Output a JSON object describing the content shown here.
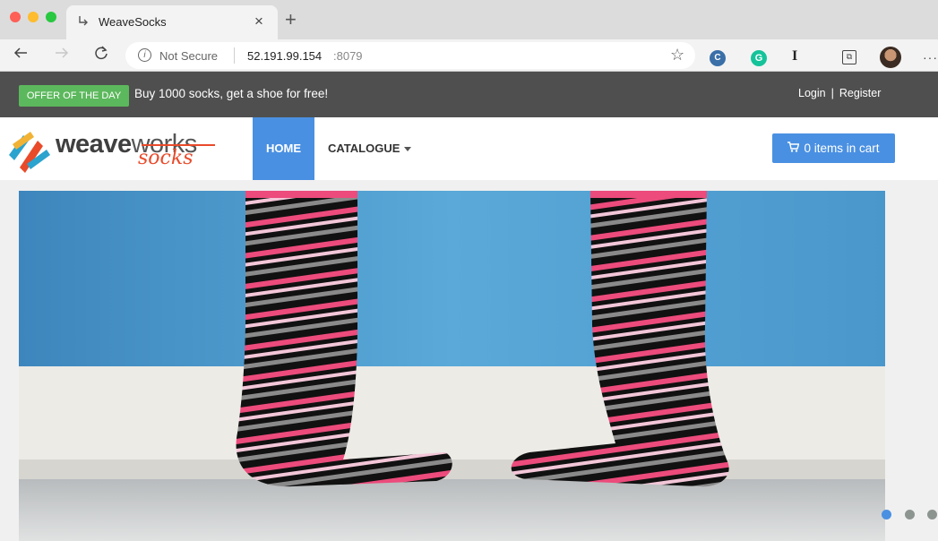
{
  "browser": {
    "tab_title": "WeaveSocks",
    "tab_close": "×",
    "new_tab": "+",
    "security_label": "Not Secure",
    "url_host": "52.191.99.154",
    "url_port": ":8079",
    "extensions": [
      "C",
      "G",
      "I",
      "⧉"
    ]
  },
  "offer": {
    "badge": "OFFER OF THE DAY",
    "text": "Buy 1000 socks, get a shoe for free!"
  },
  "auth": {
    "login": "Login",
    "separator": "|",
    "register": "Register"
  },
  "logo": {
    "word_weave": "weave",
    "word_works": "works",
    "word_socks": "socks"
  },
  "nav": {
    "home": "HOME",
    "catalogue": "CATALOGUE"
  },
  "cart": {
    "label": "0 items in cart"
  },
  "carousel": {
    "slide_count": 3,
    "active_index": 0
  },
  "colors": {
    "offer_bar": "#4f4f4f",
    "offer_badge": "#5cb85c",
    "accent": "#4a90e2",
    "logo_red": "#e94a2a",
    "sock_pink": "#ec4b7c"
  }
}
